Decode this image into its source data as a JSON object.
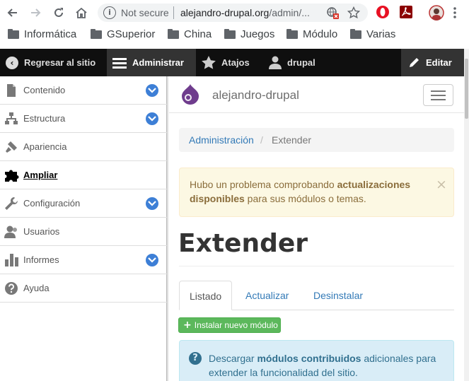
{
  "browser": {
    "security_label": "Not secure",
    "url_domain": "alejandro-drupal.org",
    "url_path": "/admin/...",
    "icons": [
      "back-icon",
      "forward-icon",
      "reload-icon",
      "home-icon",
      "info-icon",
      "translate-blocked-icon",
      "star-icon",
      "opera-extension-icon",
      "pdf-extension-icon",
      "profile-avatar"
    ]
  },
  "bookmarks": [
    {
      "label": "Informática"
    },
    {
      "label": "GSuperior"
    },
    {
      "label": "China"
    },
    {
      "label": "Juegos"
    },
    {
      "label": "Módulo"
    },
    {
      "label": "Varias"
    }
  ],
  "toolbar": {
    "back_label": "Regresar al sitio",
    "manage_label": "Administrar",
    "shortcuts_label": "Atajos",
    "user_label": "drupal",
    "edit_label": "Editar"
  },
  "sidebar": {
    "items": [
      {
        "label": "Contenido",
        "expandable": true
      },
      {
        "label": "Estructura",
        "expandable": true
      },
      {
        "label": "Apariencia",
        "expandable": false
      },
      {
        "label": "Ampliar",
        "expandable": false,
        "active": true
      },
      {
        "label": "Configuración",
        "expandable": true
      },
      {
        "label": "Usuarios",
        "expandable": false
      },
      {
        "label": "Informes",
        "expandable": true
      },
      {
        "label": "Ayuda",
        "expandable": false
      }
    ]
  },
  "header": {
    "site_name": "alejandro-drupal"
  },
  "breadcrumb": {
    "link": "Administración",
    "separator": "/",
    "current": "Extender"
  },
  "alert": {
    "text_before": "Hubo un problema comprobando ",
    "text_bold": "actualizaciones disponibles",
    "text_after": " para sus módulos o temas.",
    "close": "×"
  },
  "page": {
    "title": "Extender"
  },
  "tabs": [
    {
      "label": "Listado",
      "active": true
    },
    {
      "label": "Actualizar",
      "active": false
    },
    {
      "label": "Desinstalar",
      "active": false
    }
  ],
  "install_button": {
    "label": "Instalar nuevo módulo"
  },
  "info": {
    "text_before": "Descargar ",
    "text_bold": "módulos contribuidos",
    "text_after": " adicionales para extender la funcionalidad del sitio."
  },
  "colors": {
    "toolbar_bg": "#0f0f0f",
    "chevron_blue": "#3d7fd6",
    "link_blue": "#337ab7",
    "success_green": "#5cb85c",
    "drupal_purple": "#6f3c8d"
  }
}
